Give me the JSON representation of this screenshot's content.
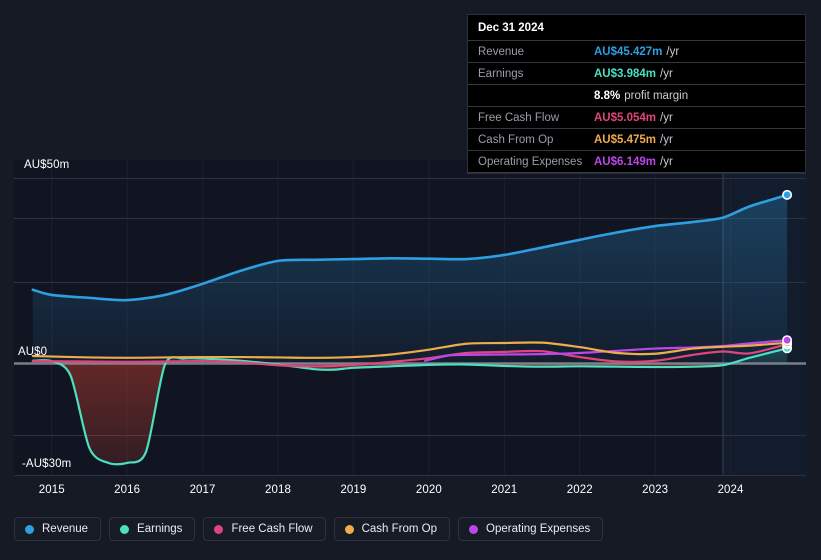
{
  "chart_data": {
    "type": "area",
    "title": "",
    "currency": "AU$",
    "unit": "m",
    "xlabel": "",
    "ylabel": "",
    "ylim": [
      -30,
      50
    ],
    "xlim": [
      2014.5,
      2025.0
    ],
    "grid": true,
    "legend_position": "bottom",
    "x_tick_labels": [
      "2015",
      "2016",
      "2017",
      "2018",
      "2019",
      "2020",
      "2021",
      "2022",
      "2023",
      "2024"
    ],
    "y_tick_labels": [
      "AU$50m",
      "AU$0",
      "-AU$30m"
    ],
    "y_tick_values": [
      50,
      0,
      -30
    ],
    "forecast_start_x": 2023.9,
    "series": [
      {
        "name": "Revenue",
        "color": "#2e9fe0",
        "x": [
          2014.75,
          2015.0,
          2015.5,
          2016.0,
          2016.5,
          2017.0,
          2017.5,
          2018.0,
          2018.5,
          2019.0,
          2019.5,
          2020.0,
          2020.5,
          2021.0,
          2021.5,
          2022.0,
          2022.5,
          2023.0,
          2023.5,
          2023.9,
          2024.25,
          2024.75
        ],
        "values": [
          19.8,
          18.4,
          17.6,
          17.0,
          18.4,
          21.4,
          24.9,
          27.6,
          27.9,
          28.1,
          28.3,
          28.2,
          28.1,
          29.2,
          31.2,
          33.3,
          35.3,
          37.0,
          38.1,
          39.3,
          42.3,
          45.427
        ]
      },
      {
        "name": "Earnings",
        "color": "#4ae0c0",
        "x": [
          2014.75,
          2015.0,
          2015.25,
          2015.5,
          2015.75,
          2016.0,
          2016.25,
          2016.5,
          2016.75,
          2017.0,
          2017.5,
          2018.0,
          2018.5,
          2018.75,
          2019.0,
          2019.5,
          2020.0,
          2020.5,
          2021.0,
          2021.5,
          2022.0,
          2022.5,
          2023.0,
          2023.5,
          2023.9,
          2024.25,
          2024.75
        ],
        "values": [
          0.6,
          0.5,
          -3.4,
          -23.0,
          -27.0,
          -27.0,
          -24.0,
          -0.5,
          1.2,
          1.2,
          0.6,
          -0.4,
          -1.7,
          -1.8,
          -1.3,
          -0.9,
          -0.5,
          -0.4,
          -0.8,
          -1.0,
          -0.9,
          -1.0,
          -1.1,
          -1.0,
          -0.6,
          1.4,
          3.984
        ]
      },
      {
        "name": "Free Cash Flow",
        "color": "#e0447e",
        "x": [
          2014.75,
          2015.5,
          2016.0,
          2016.5,
          2017.0,
          2017.5,
          2018.0,
          2018.5,
          2019.0,
          2019.5,
          2020.0,
          2020.5,
          2021.0,
          2021.5,
          2022.0,
          2022.5,
          2023.0,
          2023.5,
          2023.9,
          2024.25,
          2024.75
        ],
        "values": [
          0.5,
          0.4,
          0.3,
          0.4,
          0.5,
          0.2,
          -0.6,
          -0.9,
          -0.5,
          0.3,
          1.3,
          2.7,
          3.0,
          3.2,
          1.6,
          0.4,
          0.6,
          2.2,
          3.1,
          2.6,
          5.054
        ]
      },
      {
        "name": "Cash From Op",
        "color": "#efab4c",
        "x": [
          2014.75,
          2015.5,
          2016.0,
          2016.5,
          2017.0,
          2017.5,
          2018.0,
          2018.5,
          2019.0,
          2019.5,
          2020.0,
          2020.5,
          2021.0,
          2021.5,
          2022.0,
          2022.5,
          2023.0,
          2023.5,
          2023.9,
          2024.25,
          2024.75
        ],
        "values": [
          1.9,
          1.5,
          1.4,
          1.5,
          1.6,
          1.6,
          1.5,
          1.4,
          1.6,
          2.3,
          3.6,
          5.2,
          5.4,
          5.5,
          4.3,
          2.7,
          2.5,
          3.9,
          4.4,
          4.7,
          5.475
        ]
      },
      {
        "name": "Operating Expenses",
        "color": "#bb46ea",
        "x": [
          2019.95,
          2020.25,
          2020.5,
          2021.0,
          2021.5,
          2022.0,
          2022.5,
          2023.0,
          2023.5,
          2023.9,
          2024.25,
          2024.75
        ],
        "values": [
          0.6,
          2.0,
          2.2,
          2.3,
          2.4,
          2.7,
          3.3,
          3.9,
          4.2,
          4.6,
          5.3,
          6.149
        ]
      }
    ]
  },
  "tooltip": {
    "title": "Dec 31 2024",
    "rows": [
      {
        "label": "Revenue",
        "value": "AU$45.427m",
        "unit": "/yr",
        "color": "#2e9fe0",
        "sub": ""
      },
      {
        "label": "Earnings",
        "value": "AU$3.984m",
        "unit": "/yr",
        "color": "#4ae0c0",
        "sub": ""
      },
      {
        "label": "",
        "value": "8.8%",
        "unit": "",
        "color": "#ffffff",
        "sub": "profit margin"
      },
      {
        "label": "Free Cash Flow",
        "value": "AU$5.054m",
        "unit": "/yr",
        "color": "#e0447e",
        "sub": ""
      },
      {
        "label": "Cash From Op",
        "value": "AU$5.475m",
        "unit": "/yr",
        "color": "#efab4c",
        "sub": ""
      },
      {
        "label": "Operating Expenses",
        "value": "AU$6.149m",
        "unit": "/yr",
        "color": "#bb46ea",
        "sub": ""
      }
    ]
  },
  "legend": {
    "items": [
      {
        "label": "Revenue",
        "color": "#2e9fe0"
      },
      {
        "label": "Earnings",
        "color": "#4ae0c0"
      },
      {
        "label": "Free Cash Flow",
        "color": "#e0447e"
      },
      {
        "label": "Cash From Op",
        "color": "#efab4c"
      },
      {
        "label": "Operating Expenses",
        "color": "#bb46ea"
      }
    ]
  },
  "theme": {
    "background": "#151a25",
    "grid_color": "#2c3240",
    "zero_line_color": "#8c9099",
    "axis_text": "#ffffff"
  }
}
